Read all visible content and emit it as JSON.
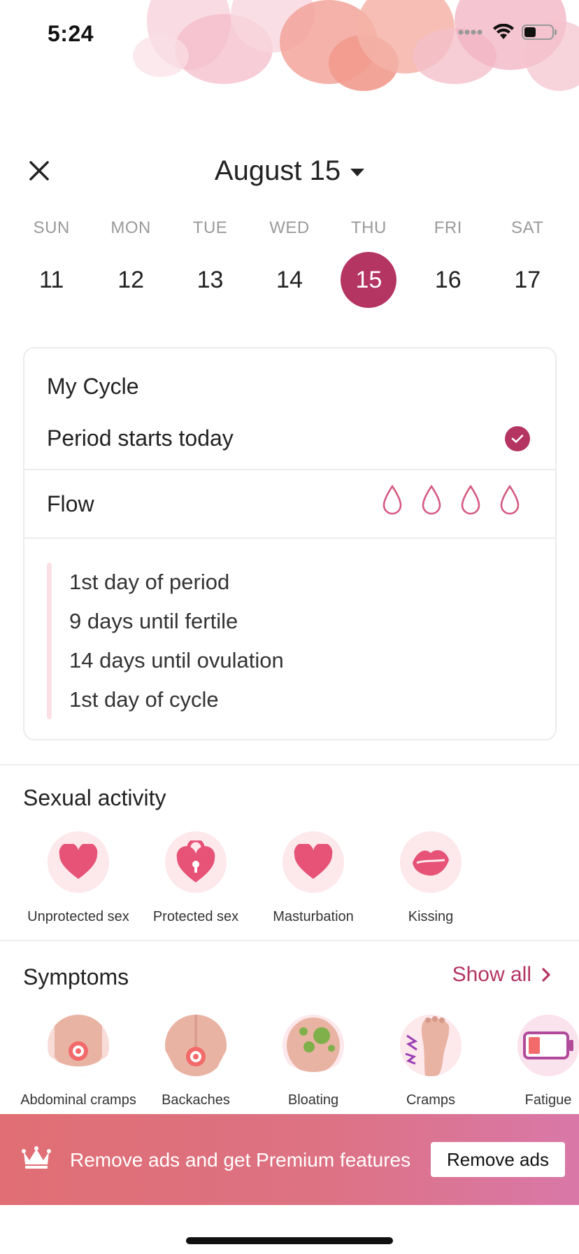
{
  "status_bar": {
    "time": "5:24"
  },
  "header": {
    "title": "August 15"
  },
  "week": [
    {
      "dow": "SUN",
      "num": "11"
    },
    {
      "dow": "MON",
      "num": "12"
    },
    {
      "dow": "TUE",
      "num": "13"
    },
    {
      "dow": "WED",
      "num": "14"
    },
    {
      "dow": "THU",
      "num": "15",
      "selected": true
    },
    {
      "dow": "FRI",
      "num": "16"
    },
    {
      "dow": "SAT",
      "num": "17"
    }
  ],
  "cycle": {
    "title": "My Cycle",
    "period_label": "Period starts today",
    "period_checked": true,
    "flow_label": "Flow",
    "flow_level": 0,
    "flow_max": 4,
    "info": [
      "1st day of period",
      "9 days until fertile",
      "14 days until ovulation",
      "1st day of cycle"
    ]
  },
  "sexual_activity": {
    "title": "Sexual activity",
    "items": [
      {
        "label": "Unprotected sex",
        "icon": "heart-icon"
      },
      {
        "label": "Protected sex",
        "icon": "heart-lock-icon"
      },
      {
        "label": "Masturbation",
        "icon": "heart-icon"
      },
      {
        "label": "Kissing",
        "icon": "lips-icon"
      }
    ]
  },
  "symptoms": {
    "title": "Symptoms",
    "show_all": "Show all",
    "items": [
      {
        "label": "Abdominal cramps",
        "icon": "abdominal-cramps-icon"
      },
      {
        "label": "Backaches",
        "icon": "backaches-icon"
      },
      {
        "label": "Bloating",
        "icon": "bloating-icon"
      },
      {
        "label": "Cramps",
        "icon": "foot-cramps-icon"
      },
      {
        "label": "Fatigue",
        "icon": "low-battery-icon"
      }
    ]
  },
  "banner": {
    "text": "Remove ads and get Premium features",
    "button": "Remove ads"
  },
  "colors": {
    "accent": "#b43462",
    "pink_light": "#fde8ec",
    "banner_start": "#e06e74",
    "banner_end": "#d978a8"
  }
}
